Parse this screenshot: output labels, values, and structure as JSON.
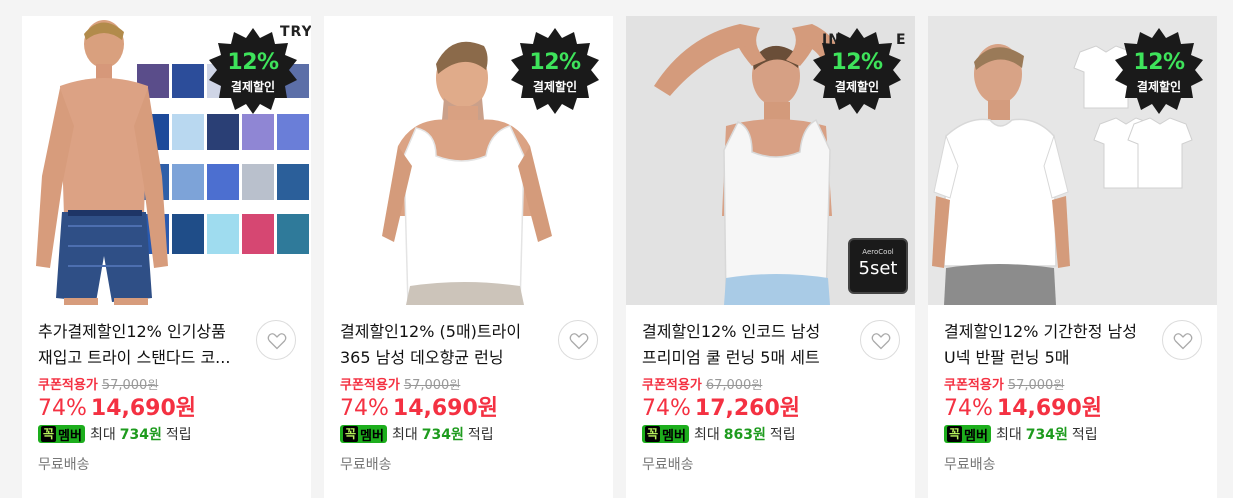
{
  "badge": {
    "percent": "12%",
    "label": "결제할인"
  },
  "common": {
    "coupon_label": "쿠폰적용가",
    "member_k": "꼭",
    "member_m": "멤버",
    "member_prefix": "최대",
    "member_suffix": "적립",
    "shipping": "무료배송"
  },
  "products": [
    {
      "brand_text": "TRY",
      "title": "추가결제할인12% 인기상품 재입고 트라이 스탠다드 코...",
      "original_price": "57,000",
      "won": "원",
      "discount_rate": "74%",
      "sale_price": "14,690원",
      "points": "734원"
    },
    {
      "title": "결제할인12% (5매)트라이 365 남성 데오향균 런닝",
      "original_price": "57,000",
      "won": "원",
      "discount_rate": "74%",
      "sale_price": "14,690원",
      "points": "734원"
    },
    {
      "brand_text": "IN",
      "brand_text2": "E",
      "set_badge_top": "AeroCool",
      "set_badge_main": "5set",
      "title": "결제할인12% 인코드 남성 프리미엄 쿨 런닝 5매 세트",
      "original_price": "67,000",
      "won": "원",
      "discount_rate": "74%",
      "sale_price": "17,260원",
      "points": "863원"
    },
    {
      "title": "결제할인12% 기간한정 남성 U넥 반팔 런닝 5매",
      "original_price": "57,000",
      "won": "원",
      "discount_rate": "74%",
      "sale_price": "14,690원",
      "points": "734원"
    }
  ]
}
